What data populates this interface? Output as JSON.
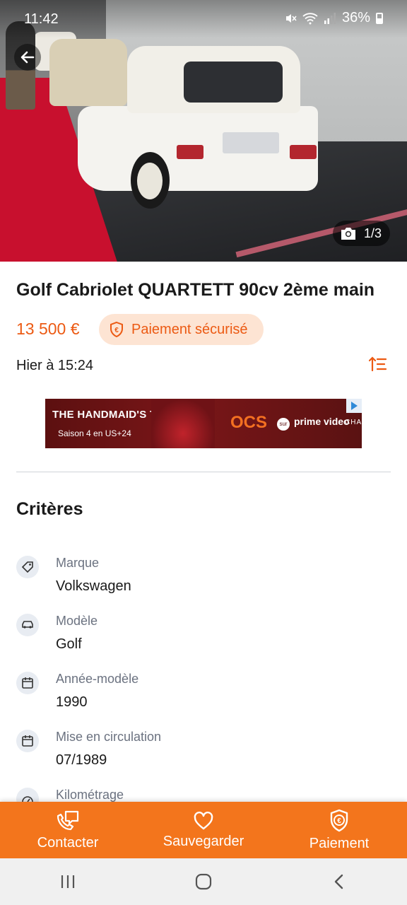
{
  "status_bar": {
    "time": "11:42",
    "battery": "36%"
  },
  "gallery": {
    "counter": "1/3"
  },
  "listing": {
    "title": "Golf Cabriolet QUARTETT 90cv 2ème main",
    "price": "13 500 €",
    "secure_payment": "Paiement sécurisé",
    "date": "Hier à 15:24"
  },
  "ad": {
    "show": "THE HANDMAID'S TALE",
    "subtitle": "Saison 4 en US+24",
    "brand": "OCS",
    "sur": "sur",
    "service": "prime video",
    "channels": "CHANNELS"
  },
  "criteria": {
    "title": "Critères",
    "items": [
      {
        "label": "Marque",
        "value": "Volkswagen",
        "icon": "tag-icon"
      },
      {
        "label": "Modèle",
        "value": "Golf",
        "icon": "car-icon"
      },
      {
        "label": "Année-modèle",
        "value": "1990",
        "icon": "calendar-icon"
      },
      {
        "label": "Mise en circulation",
        "value": "07/1989",
        "icon": "calendar-icon"
      },
      {
        "label": "Kilométrage",
        "value": "",
        "icon": "speedometer-icon"
      }
    ]
  },
  "actions": {
    "contact": "Contacter",
    "save": "Sauvegarder",
    "payment": "Paiement"
  },
  "colors": {
    "accent": "#f3751c",
    "price": "#ec5a13",
    "badge_bg": "#fde4d3"
  }
}
